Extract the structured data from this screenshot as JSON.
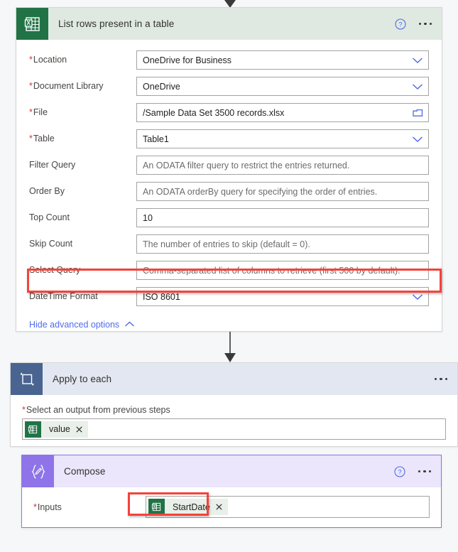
{
  "colors": {
    "excel_green": "#217346",
    "excel_header_bg": "#dfe9e1",
    "loop_icon_bg": "#4a6491",
    "loop_header_bg": "#e3e7f1",
    "compose_purple": "#8e74e8",
    "compose_header_bg": "#ebe6fb",
    "highlight_red": "#f4433a",
    "link_blue": "#4f6bed",
    "required_red": "#d13438",
    "canvas_bg": "#f6f7f8"
  },
  "excel_action": {
    "title": "List rows present in a table",
    "icon": "excel-icon",
    "help_icon": "help-circle-icon",
    "more_icon": "ellipsis-icon",
    "fields": [
      {
        "label": "Location",
        "required": true,
        "value": "OneDrive for Business",
        "placeholder": "",
        "control": "dropdown"
      },
      {
        "label": "Document Library",
        "required": true,
        "value": "OneDrive",
        "placeholder": "",
        "control": "dropdown"
      },
      {
        "label": "File",
        "required": true,
        "value": "/Sample Data Set 3500 records.xlsx",
        "placeholder": "",
        "control": "filepicker"
      },
      {
        "label": "Table",
        "required": true,
        "value": "Table1",
        "placeholder": "",
        "control": "dropdown"
      },
      {
        "label": "Filter Query",
        "required": false,
        "value": "",
        "placeholder": "An ODATA filter query to restrict the entries returned.",
        "control": "text"
      },
      {
        "label": "Order By",
        "required": false,
        "value": "",
        "placeholder": "An ODATA orderBy query for specifying the order of entries.",
        "control": "text"
      },
      {
        "label": "Top Count",
        "required": false,
        "value": "10",
        "placeholder": "",
        "control": "text"
      },
      {
        "label": "Skip Count",
        "required": false,
        "value": "",
        "placeholder": "The number of entries to skip (default = 0).",
        "control": "text"
      },
      {
        "label": "Select Query",
        "required": false,
        "value": "",
        "placeholder": "Comma-separated list of columns to retrieve (first 500 by default).",
        "control": "text"
      },
      {
        "label": "DateTime Format",
        "required": false,
        "value": "ISO 8601",
        "placeholder": "",
        "control": "dropdown",
        "highlighted": true
      }
    ],
    "advanced_link": {
      "label": "Hide advanced options",
      "icon": "chevron-up-icon"
    }
  },
  "apply_to_each": {
    "title": "Apply to each",
    "icon": "loop-icon",
    "more_icon": "ellipsis-icon",
    "output_label": "Select an output from previous steps",
    "output_required": true,
    "token": {
      "text": "value",
      "icon": "excel-icon",
      "remove_icon": "close-icon"
    }
  },
  "compose": {
    "title": "Compose",
    "icon": "compose-braces-icon",
    "help_icon": "help-circle-icon",
    "more_icon": "ellipsis-icon",
    "inputs_label": "Inputs",
    "inputs_required": true,
    "token": {
      "text": "StartDate",
      "icon": "excel-icon",
      "remove_icon": "close-icon",
      "highlighted": true
    }
  }
}
